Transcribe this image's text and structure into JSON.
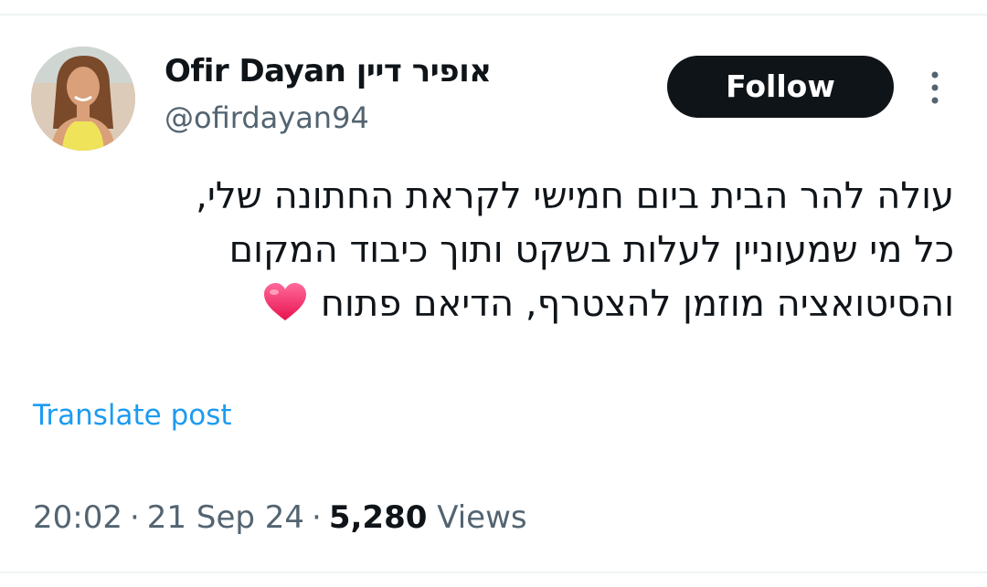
{
  "author": {
    "display_name": "Ofir Dayan אופיר דיין",
    "handle": "@ofirdayan94"
  },
  "actions": {
    "follow_label": "Follow",
    "more_icon": "more-vertical-icon",
    "translate_label": "Translate post"
  },
  "tweet": {
    "lines": [
      "עולה להר הבית ביום חמישי לקראת החתונה שלי,",
      "כל מי שמעוניין לעלות בשקט ותוך כיבוד המקום",
      "והסיטואציה מוזמן להצטרף, הדיאם פתוח"
    ],
    "emoji": "red-heart-icon"
  },
  "meta": {
    "time": "20:02",
    "separator": "·",
    "date": "21 Sep 24",
    "views_count": "5,280",
    "views_label": "Views"
  },
  "colors": {
    "text_primary": "#0f1419",
    "text_secondary": "#536471",
    "link": "#1d9bf0",
    "follow_bg": "#0f1419",
    "heart": "#f91880"
  }
}
